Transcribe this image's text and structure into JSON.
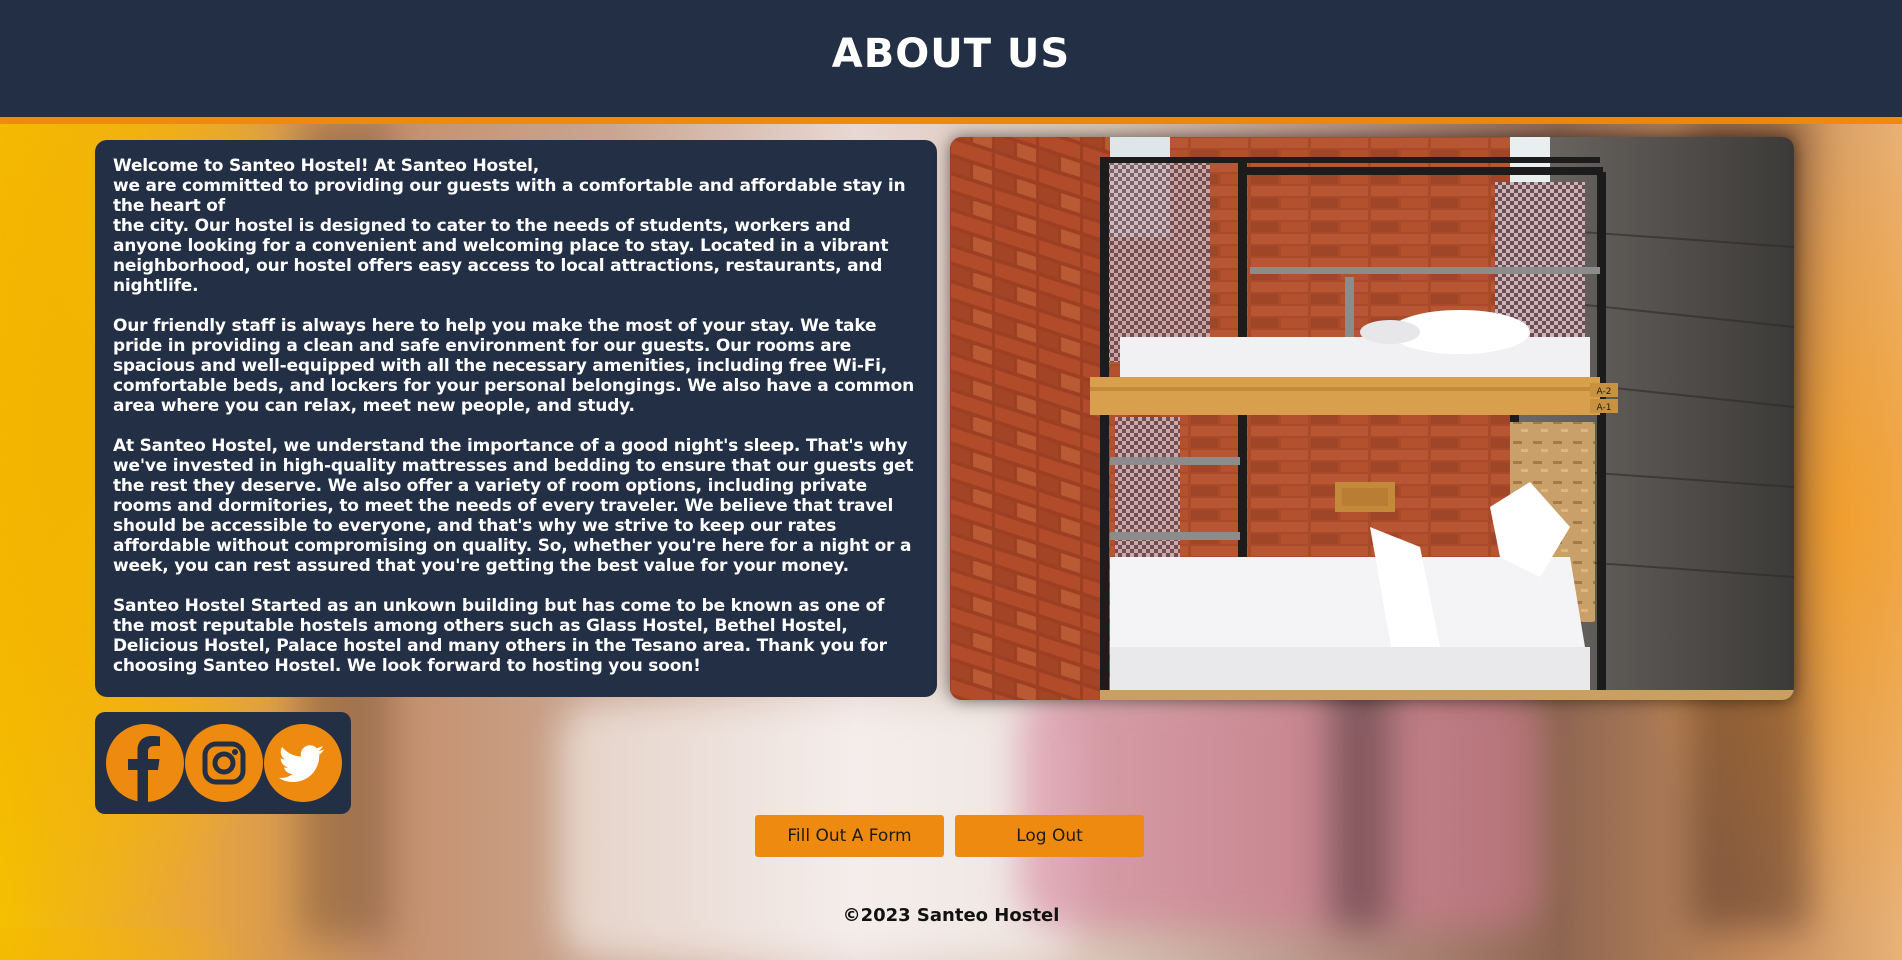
{
  "header": {
    "title": "ABOUT US"
  },
  "about": {
    "paragraphs": [
      {
        "line1": "Welcome to Santeo Hostel! At Santeo Hostel,",
        "line2": "we are committed to providing our guests with a comfortable and affordable stay in the heart of",
        "line3": "the city. Our hostel is designed to cater to the needs of students, workers and anyone looking for a convenient and welcoming place to stay. Located in a vibrant neighborhood, our hostel offers easy access to local attractions, restaurants, and nightlife."
      },
      "Our friendly staff is always here to help you make the most of your stay. We take pride in providing a clean and safe environment for our guests. Our rooms are spacious and well-equipped with all the necessary amenities, including free Wi-Fi, comfortable beds, and lockers for your personal belongings. We also have a common area where you can relax, meet new people, and study.",
      "At Santeo Hostel, we understand the importance of a good night's sleep. That's why we've invested in high-quality mattresses and bedding to ensure that our guests get the rest they deserve. We also offer a variety of room options, including private rooms and dormitories, to meet the needs of every traveler. We believe that travel should be accessible to everyone, and that's why we strive to keep our rates affordable without compromising on quality. So, whether you're here for a night or a week, you can rest assured that you're getting the best value for your money.",
      "Santeo Hostel Started as an unkown building but has come to be known as one of the most reputable hostels among others such as Glass Hostel, Bethel Hostel, Delicious Hostel, Palace hostel and many others in the Tesano area. Thank you for choosing Santeo Hostel. We look forward to hosting you soon!"
    ]
  },
  "photo": {
    "labels": {
      "top": "A-2",
      "bottom": "A-1"
    }
  },
  "social": {
    "icons": [
      "facebook-icon",
      "instagram-icon",
      "twitter-icon"
    ]
  },
  "actions": {
    "form_label": "Fill Out A Form",
    "logout_label": "Log Out"
  },
  "footer": {
    "text": "©2023 Santeo Hostel"
  },
  "colors": {
    "navy": "#232f45",
    "accent": "#ef8a10"
  }
}
